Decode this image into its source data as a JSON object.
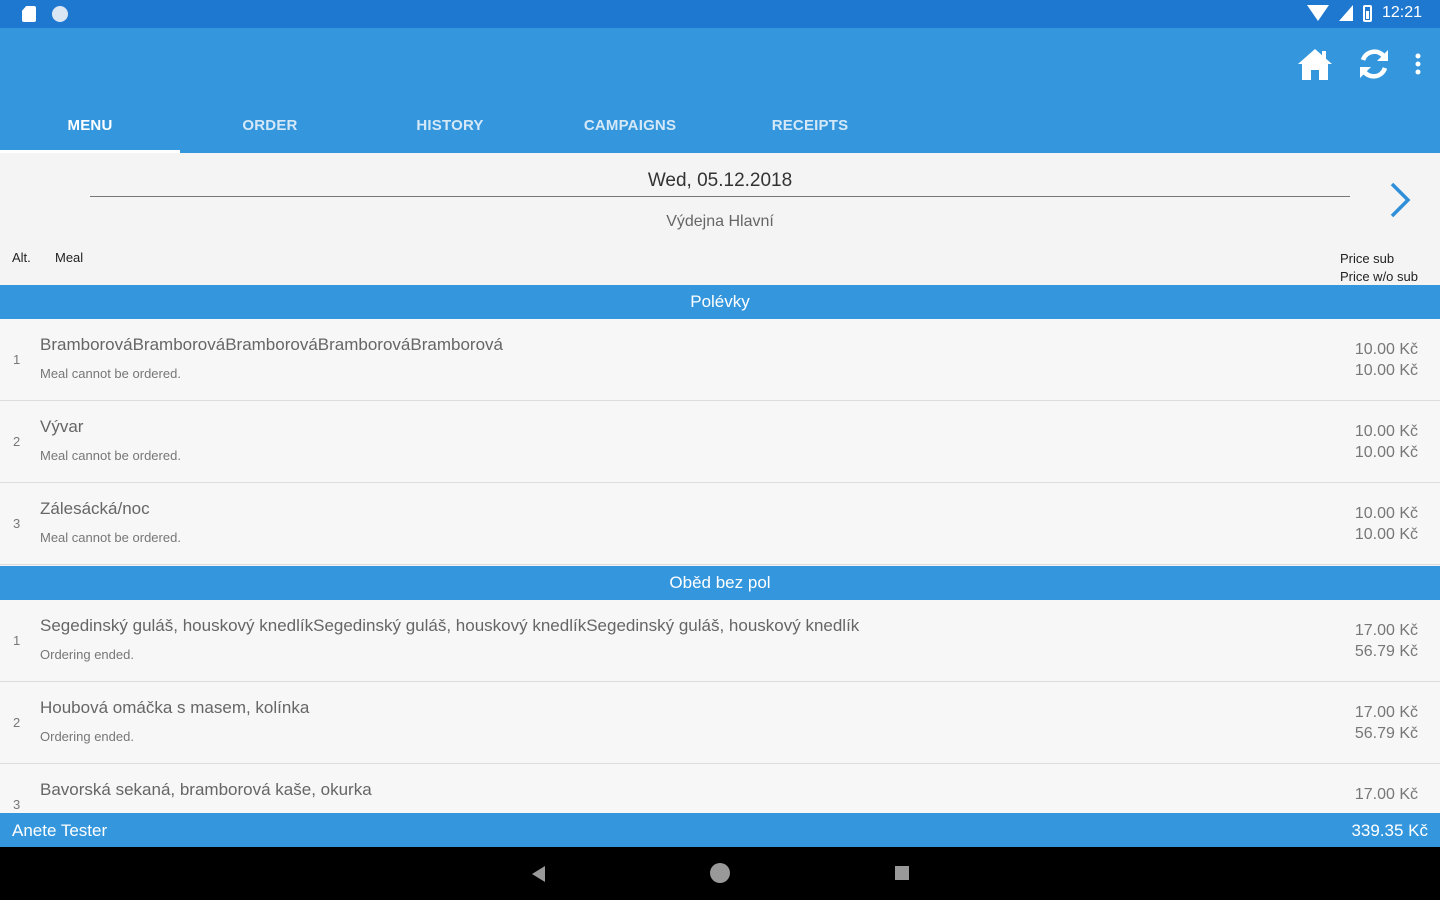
{
  "status_bar": {
    "time": "12:21"
  },
  "tabs": [
    {
      "label": "MENU",
      "active": true
    },
    {
      "label": "ORDER",
      "active": false
    },
    {
      "label": "HISTORY",
      "active": false
    },
    {
      "label": "CAMPAIGNS",
      "active": false
    },
    {
      "label": "RECEIPTS",
      "active": false
    }
  ],
  "header": {
    "date": "Wed, 05.12.2018",
    "location": "Výdejna Hlavní"
  },
  "columns": {
    "alt": "Alt.",
    "meal": "Meal",
    "price_sub": "Price sub",
    "price_wo_sub": "Price w/o sub"
  },
  "sections": [
    {
      "title": "Polévky",
      "items": [
        {
          "alt": "1",
          "name": "BramborováBramborováBramborováBramborováBramborová",
          "note": "Meal cannot be ordered.",
          "price_sub": "10.00 Kč",
          "price_wo_sub": "10.00 Kč"
        },
        {
          "alt": "2",
          "name": "Vývar",
          "note": "Meal cannot be ordered.",
          "price_sub": "10.00 Kč",
          "price_wo_sub": "10.00 Kč"
        },
        {
          "alt": "3",
          "name": "Zálesácká/noc",
          "note": "Meal cannot be ordered.",
          "price_sub": "10.00 Kč",
          "price_wo_sub": "10.00 Kč"
        }
      ]
    },
    {
      "title": "Oběd bez pol",
      "items": [
        {
          "alt": "1",
          "name": "Segedinský guláš, houskový knedlíkSegedinský guláš, houskový knedlíkSegedinský guláš, houskový knedlík",
          "note": "Ordering ended.",
          "price_sub": "17.00 Kč",
          "price_wo_sub": "56.79 Kč"
        },
        {
          "alt": "2",
          "name": "Houbová omáčka s masem, kolínka",
          "note": "Ordering ended.",
          "price_sub": "17.00 Kč",
          "price_wo_sub": "56.79 Kč"
        },
        {
          "alt": "3",
          "name": "Bavorská sekaná, bramborová kaše, okurka",
          "note": "",
          "price_sub": "17.00 Kč",
          "price_wo_sub": ""
        }
      ]
    }
  ],
  "footer": {
    "user": "Anete Tester",
    "total": "339.35 Kč"
  },
  "colors": {
    "status_bar": "#1e78cf",
    "primary": "#3497dd",
    "nav_bar": "#000000"
  },
  "icons": [
    "home-icon",
    "refresh-icon",
    "more-vert-icon",
    "chevron-right-icon",
    "back-icon",
    "home-nav-icon",
    "recents-icon"
  ]
}
